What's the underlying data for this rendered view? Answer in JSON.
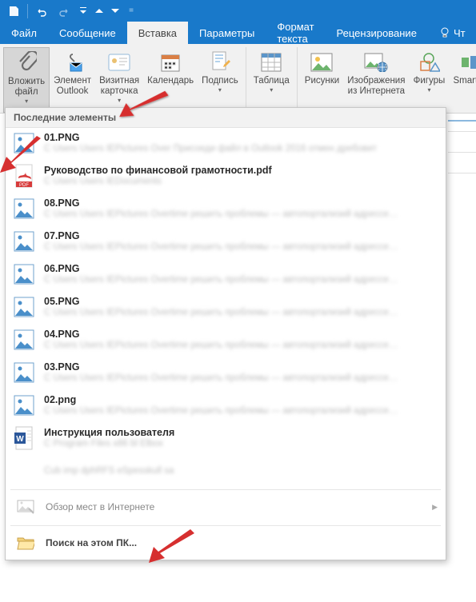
{
  "tabs": {
    "file": "Файл",
    "message": "Сообщение",
    "insert": "Вставка",
    "params": "Параметры",
    "format": "Формат текста",
    "review": "Рецензирование",
    "tell": "Чт"
  },
  "ribbon": {
    "attach": "Вложить\nфайл",
    "outlook_elem": "Элемент\nOutlook",
    "bizcard": "Визитная\nкарточка",
    "calendar": "Календарь",
    "signature": "Подпись",
    "table": "Таблица",
    "pictures": "Рисунки",
    "online_pics": "Изображения\nиз Интернета",
    "shapes": "Фигуры",
    "smartart": "SmartArt"
  },
  "panel": {
    "header": "Последние элементы",
    "items": [
      {
        "name": "01.PNG",
        "type": "png",
        "path": "C Users Users IEPictures Over Присоеди файл в Outlook 2016 отмен дребовит"
      },
      {
        "name": "Руководство по финансовой грамотности.pdf",
        "type": "pdf",
        "path": "C Users Users IEDocuments"
      },
      {
        "name": "08.PNG",
        "type": "png",
        "path": "C Users Users IEPictures Overtime решить проблемы — автопортализий адрессе…"
      },
      {
        "name": "07.PNG",
        "type": "png",
        "path": "C Users Users IEPictures Overtime решить проблемы — автопортализий адрессе…"
      },
      {
        "name": "06.PNG",
        "type": "png",
        "path": "C Users Users IEPictures Overtime решить проблемы — автопортализий адрессе…"
      },
      {
        "name": "05.PNG",
        "type": "png",
        "path": "C Users Users IEPictures Overtime решить проблемы — автопортализий адрессе…"
      },
      {
        "name": "04.PNG",
        "type": "png",
        "path": "C Users Users IEPictures Overtime решить проблемы — автопортализий адрессе…"
      },
      {
        "name": "03.PNG",
        "type": "png",
        "path": "C Users Users IEPictures Overtime решить проблемы — автопортализий адрессе…"
      },
      {
        "name": "02.png",
        "type": "png",
        "path": "C Users Users IEPictures Overtime решить проблемы — автопортализий адрессе…"
      },
      {
        "name": "Инструкция пользователя",
        "type": "docx",
        "path": "C Program Files x86 bl Elbox"
      },
      {
        "name": "",
        "type": "none",
        "path": "Cub imp dphRFS eSpesskull sa"
      }
    ],
    "browse_web": "Обзор мест в Интернете",
    "browse_pc": "Поиск на этом ПК..."
  }
}
